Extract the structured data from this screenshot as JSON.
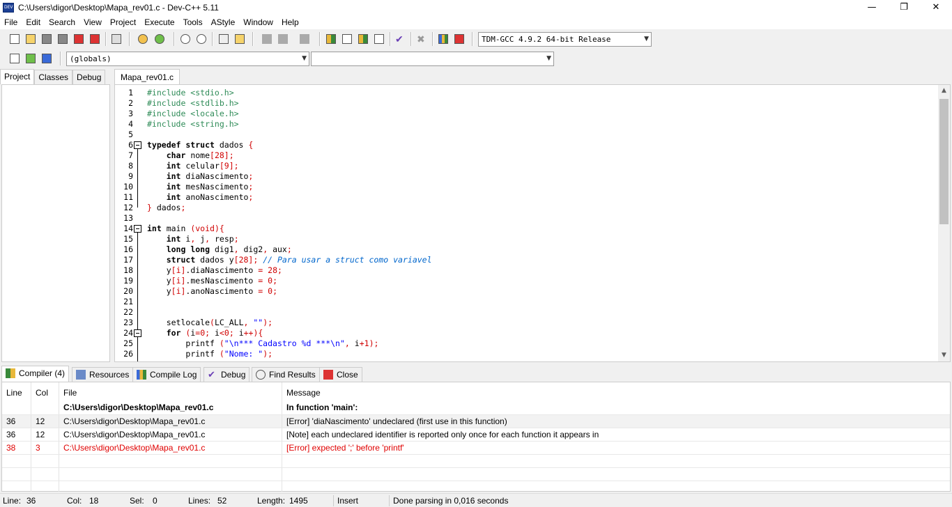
{
  "window": {
    "title": "C:\\Users\\digor\\Desktop\\Mapa_rev01.c - Dev-C++ 5.11",
    "minimize": "—",
    "restore": "❐",
    "close": "✕"
  },
  "menu": [
    "File",
    "Edit",
    "Search",
    "View",
    "Project",
    "Execute",
    "Tools",
    "AStyle",
    "Window",
    "Help"
  ],
  "toolbar": {
    "compiler_select": "TDM-GCC 4.9.2 64-bit Release",
    "scope_select": "(globals)",
    "function_select": ""
  },
  "left_panel": {
    "tabs": [
      "Project",
      "Classes",
      "Debug"
    ],
    "active_tab": "Project"
  },
  "editor": {
    "tab": "Mapa_rev01.c",
    "lines": [
      {
        "n": "1"
      },
      {
        "n": "2"
      },
      {
        "n": "3"
      },
      {
        "n": "4"
      },
      {
        "n": "5"
      },
      {
        "n": "6"
      },
      {
        "n": "7"
      },
      {
        "n": "8"
      },
      {
        "n": "9"
      },
      {
        "n": "10"
      },
      {
        "n": "11"
      },
      {
        "n": "12"
      },
      {
        "n": "13"
      },
      {
        "n": "14"
      },
      {
        "n": "15"
      },
      {
        "n": "16"
      },
      {
        "n": "17"
      },
      {
        "n": "18"
      },
      {
        "n": "19"
      },
      {
        "n": "20"
      },
      {
        "n": "21"
      },
      {
        "n": "22"
      },
      {
        "n": "23"
      },
      {
        "n": "24"
      },
      {
        "n": "25"
      },
      {
        "n": "26"
      }
    ],
    "code": {
      "l1": "#include <stdio.h>",
      "l2": "#include <stdlib.h>",
      "l3": "#include <locale.h>",
      "l4": "#include <string.h>",
      "l6a": "typedef struct",
      "l6b": " dados ",
      "l6c": "{",
      "l7a": "char",
      "l7b": " nome",
      "l7c": "[28];",
      "l8a": "int",
      "l8b": " celular",
      "l8c": "[9];",
      "l9a": "int",
      "l9b": " diaNascimento",
      "l9c": ";",
      "l10a": "int",
      "l10b": " mesNascimento",
      "l10c": ";",
      "l11a": "int",
      "l11b": " anoNascimento",
      "l11c": ";",
      "l12a": "}",
      "l12b": " dados",
      "l12c": ";",
      "l14a": "int",
      "l14b": " main ",
      "l14c": "(void){",
      "l15a": "int",
      "l15b": " i",
      "l15c": ",",
      "l15d": " j",
      "l15e": ",",
      "l15f": " resp",
      "l15g": ";",
      "l16a": "long long",
      "l16b": " dig1",
      "l16c": ",",
      "l16d": " dig2",
      "l16e": ",",
      "l16f": " aux",
      "l16g": ";",
      "l17a": "struct",
      "l17b": " dados y",
      "l17c": "[28];",
      "l17d": " // Para usar a struct como variavel",
      "l18a": "y",
      "l18b": "[i]",
      "l18c": ".diaNascimento ",
      "l18d": "=",
      "l18e": " 28",
      "l18f": ";",
      "l19a": "y",
      "l19b": "[i]",
      "l19c": ".mesNascimento ",
      "l19d": "=",
      "l19e": " 0",
      "l19f": ";",
      "l20a": "y",
      "l20b": "[i]",
      "l20c": ".anoNascimento ",
      "l20d": "=",
      "l20e": " 0",
      "l20f": ";",
      "l23a": "setlocale",
      "l23b": "(",
      "l23c": "LC_ALL",
      "l23d": ",",
      "l23e": " \"\"",
      "l23f": ");",
      "l24a": "for",
      "l24b": " (",
      "l24c": "i",
      "l24d": "=",
      "l24e": "0",
      "l24f": ";",
      "l24g": " i",
      "l24h": "<",
      "l24i": "0",
      "l24j": ";",
      "l24k": " i",
      "l24l": "++){",
      "l25a": "printf",
      "l25b": " (",
      "l25c": "\"\\n*** Cadastro %d ***\\n\"",
      "l25d": ",",
      "l25e": " i",
      "l25f": "+",
      "l25g": "1",
      "l25h": ");",
      "l26a": "printf",
      "l26b": " (",
      "l26c": "\"Nome: \"",
      "l26d": ");"
    }
  },
  "bottom_tabs": [
    "Compiler (4)",
    "Resources",
    "Compile Log",
    "Debug",
    "Find Results",
    "Close"
  ],
  "compiler_table": {
    "headers": {
      "line": "Line",
      "col": "Col",
      "file": "File",
      "message": "Message"
    },
    "rows": [
      {
        "line": "",
        "col": "",
        "file": "C:\\Users\\digor\\Desktop\\Mapa_rev01.c",
        "message": "In function 'main':"
      },
      {
        "line": "36",
        "col": "12",
        "file": "C:\\Users\\digor\\Desktop\\Mapa_rev01.c",
        "message": "[Error] 'diaNascimento' undeclared (first use in this function)"
      },
      {
        "line": "36",
        "col": "12",
        "file": "C:\\Users\\digor\\Desktop\\Mapa_rev01.c",
        "message": "[Note] each undeclared identifier is reported only once for each function it appears in"
      },
      {
        "line": "38",
        "col": "3",
        "file": "C:\\Users\\digor\\Desktop\\Mapa_rev01.c",
        "message": "[Error] expected ';' before 'printf'"
      }
    ]
  },
  "status": {
    "line_label": "Line:",
    "line": "36",
    "col_label": "Col:",
    "col": "18",
    "sel_label": "Sel:",
    "sel": "0",
    "lines_label": "Lines:",
    "lines": "52",
    "length_label": "Length:",
    "length": "1495",
    "mode": "Insert",
    "message": "Done parsing in 0,016 seconds"
  },
  "colors": {
    "preprocessor": "#2e8b57",
    "string": "#0000ff",
    "number": "#d00000",
    "comment": "#0066cc",
    "error": "#e00000"
  }
}
